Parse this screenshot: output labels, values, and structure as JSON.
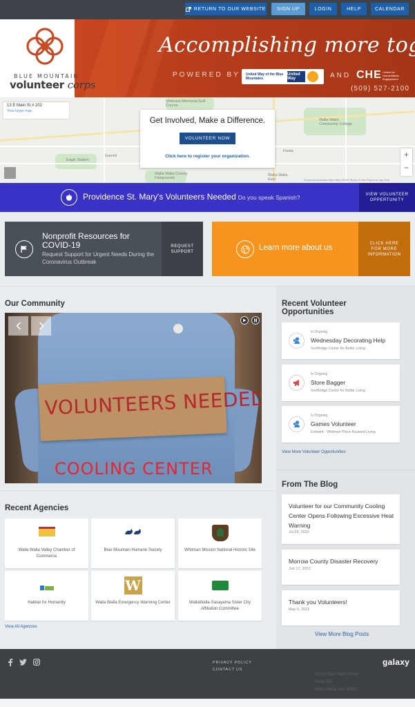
{
  "topnav": {
    "return_label": "RETURN TO OUR WEBSITE",
    "signup_label": "SIGN UP",
    "login_label": "LOGIN",
    "help_label": "HELP",
    "calendar_label": "CALENDAR"
  },
  "banner": {
    "logo_small": "BLUE MOUNTAIN",
    "logo_big_a": "volunteer",
    "logo_big_b": "corps",
    "tagline": "Accomplishing more together",
    "powered_by": "POWERED BY",
    "united_way_text": "United Way of the Blue Mountains",
    "united_way_badge": "United Way",
    "and": "AND",
    "che": "CHE",
    "che_sub": "Center for Humanitarian Engagement",
    "phone": "(509) 527-2100"
  },
  "map": {
    "address": "13 E Main St # 202",
    "larger_map": "View larger map",
    "labels": [
      "Veterans Memorial Golf Course",
      "Walla Walla Community College",
      "Garrett",
      "Fiesta",
      "Walla Walla County Fairgrounds",
      "Walla Walla East",
      "Eagle Station"
    ],
    "footer": "Keyboard shortcuts   Map data ©2022   Terms of Use   Report a map error"
  },
  "cta": {
    "heading": "Get Involved, Make a Difference.",
    "button": "VOLUNTEER NOW",
    "register": "Click here to register your organization."
  },
  "providence": {
    "title": "Providence St. Mary's Volunteers Needed",
    "sub": "Do you speak Spanish?",
    "button": "VIEW VOLUNTEER OPPERTUNITY"
  },
  "resources": {
    "covid_title": "Nonprofit Resources for COVID-19",
    "covid_sub": "Request Support for Urgent Needs During the Coronavirus Outbreak",
    "covid_button": "REQUEST SUPPORT",
    "learn_title": "Learn more about us",
    "learn_button": "CLICK HERE FOR MORE INFORMATION"
  },
  "community": {
    "heading": "Our Community",
    "sign_text": "VOLUNTEERS NEEDED",
    "overlay_text": "COOLING CENTER"
  },
  "agencies": {
    "heading": "Recent Agencies",
    "items": [
      {
        "name": "Walla Walla Valley Chamber of Commerce"
      },
      {
        "name": "Blue Mountain Humane Society"
      },
      {
        "name": "Whitman Mission National Historic Site"
      },
      {
        "name": "Habitat for Humanity"
      },
      {
        "name": "Walla Walla Emergency Warming Center"
      },
      {
        "name": "WallaWalla-Sasayama Sister City Affiliation Committee"
      }
    ],
    "view_all": "View All Agencies"
  },
  "opportunities": {
    "heading": "Recent Volunteer Opportunities",
    "items": [
      {
        "status": "Is Ongoing",
        "title": "Wednesday Decorating Help",
        "org": "SonBridge Center for Better Living",
        "icon": "people-icon"
      },
      {
        "status": "Is Ongoing",
        "title": "Store Bagger",
        "org": "SonBridge Center for Better Living",
        "icon": "megaphone-icon"
      },
      {
        "status": "Is Ongoing",
        "title": "Games Volunteer",
        "org": "Enlivant - Whitman Place Assisted Living",
        "icon": "people-icon"
      }
    ],
    "view_more": "View More Volunteer Opportunities"
  },
  "blog": {
    "heading": "From The Blog",
    "posts": [
      {
        "title": "Volunteer for our Community Cooling Center Opens Following Excessive Heat Warning",
        "date": "Jul 25, 2022"
      },
      {
        "title": "Morrow County Disaster Recovery",
        "date": "Jun 17, 2022"
      },
      {
        "title": "Thank you Volunteers!",
        "date": "May 6, 2022"
      }
    ],
    "view_more": "View More Blog Posts"
  },
  "footer": {
    "privacy": "PRIVACY POLICY",
    "contact": "CONTACT US",
    "addr1": "13 1/2 East Main Street",
    "addr2": "Suite 202",
    "addr3": "Walla Walla, WA 99362",
    "brand": "galaxy"
  },
  "colors": {
    "nav_bg": "#3e4349",
    "nav_button": "#1d5fa8",
    "banner_orange": "#c8461f",
    "providence_bar": "#3a31c6",
    "covid_card": "#4a5057",
    "learn_card": "#f7941d",
    "footer_bg": "#3d4045"
  }
}
